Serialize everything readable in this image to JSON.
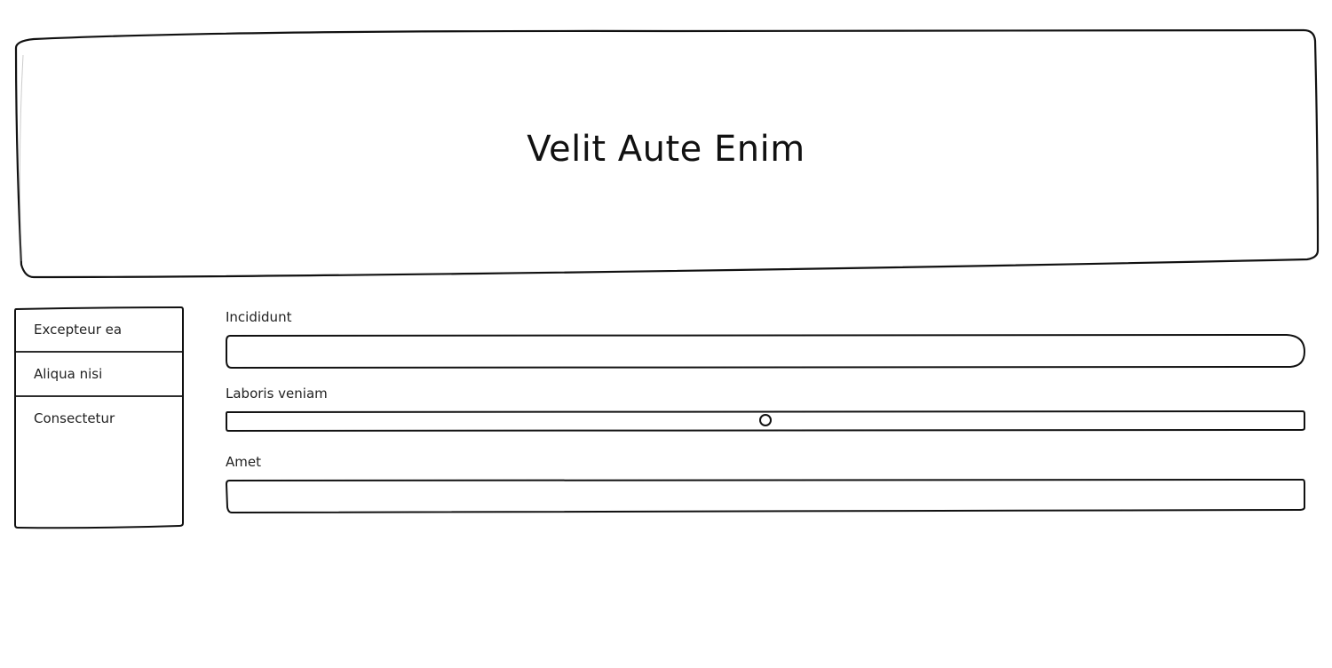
{
  "header": {
    "title": "Velit Aute Enim"
  },
  "sidebar": {
    "items": [
      {
        "label": "Excepteur ea"
      },
      {
        "label": "Aliqua nisi"
      },
      {
        "label": "Consectetur"
      }
    ]
  },
  "form": {
    "field1": {
      "label": "Incididunt",
      "value": ""
    },
    "slider": {
      "label": "Laboris veniam",
      "value": 0.5
    },
    "field2": {
      "label": "Amet",
      "value": ""
    }
  }
}
